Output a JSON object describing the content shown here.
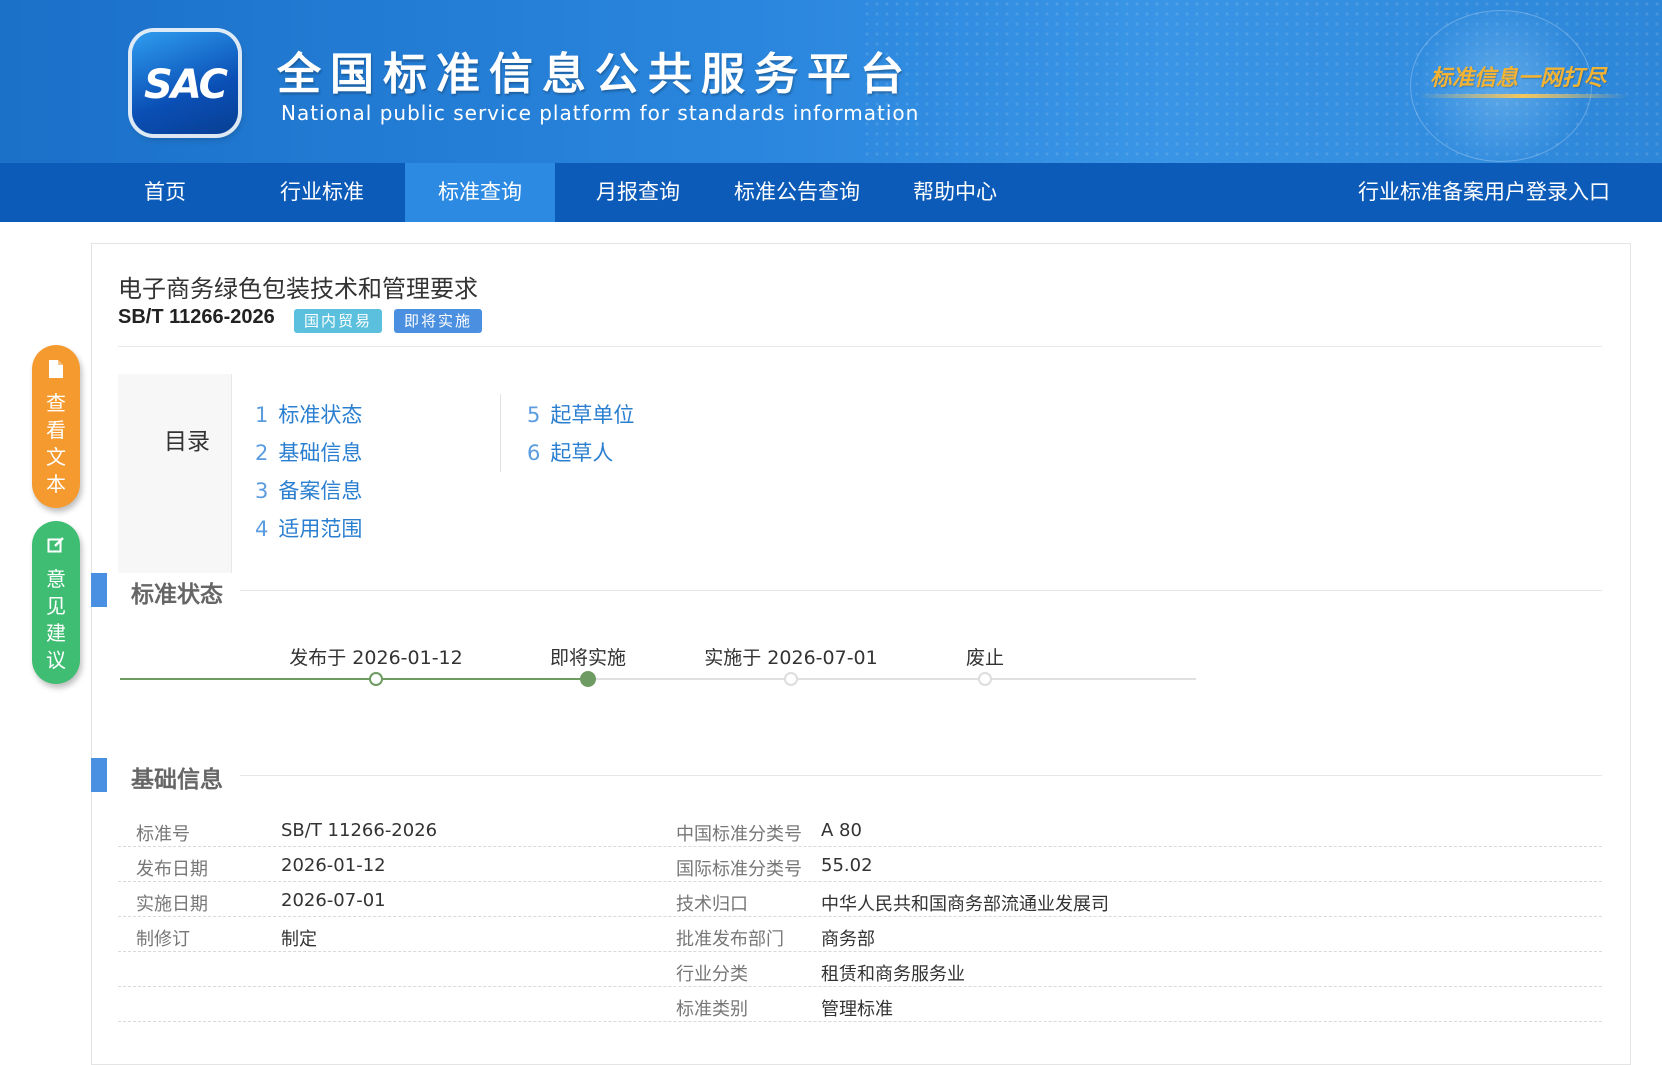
{
  "header": {
    "logo_text": "SAC",
    "title": "全国标准信息公共服务平台",
    "subtitle": "National public service platform  for standards information",
    "slogan": "标准信息一网打尽"
  },
  "nav": {
    "items": [
      {
        "label": "首页"
      },
      {
        "label": "行业标准"
      },
      {
        "label": "标准查询"
      },
      {
        "label": "月报查询"
      },
      {
        "label": "标准公告查询"
      },
      {
        "label": "帮助中心"
      }
    ],
    "active_index": 2,
    "login_label": "行业标准备案用户登录入口"
  },
  "floating": {
    "view_text": "查看文本",
    "feedback": "意见建议"
  },
  "standard": {
    "title": "电子商务绿色包装技术和管理要求",
    "code": "SB/T 11266-2026",
    "tags": [
      "国内贸易",
      "即将实施"
    ]
  },
  "toc": {
    "label": "目录",
    "col1": [
      {
        "num": "1",
        "label": "标准状态"
      },
      {
        "num": "2",
        "label": "基础信息"
      },
      {
        "num": "3",
        "label": "备案信息"
      },
      {
        "num": "4",
        "label": "适用范围"
      }
    ],
    "col2": [
      {
        "num": "5",
        "label": "起草单位"
      },
      {
        "num": "6",
        "label": "起草人"
      }
    ]
  },
  "status_section": {
    "title": "标准状态",
    "steps": [
      {
        "label": "发布于 2026-01-12",
        "state": "done"
      },
      {
        "label": "即将实施",
        "state": "current"
      },
      {
        "label": "实施于 2026-07-01",
        "state": "pending"
      },
      {
        "label": "废止",
        "state": "pending"
      }
    ]
  },
  "basic_section": {
    "title": "基础信息",
    "rows": [
      {
        "l1": "标准号",
        "v1": "SB/T 11266-2026",
        "l2": "中国标准分类号",
        "v2": "A 80"
      },
      {
        "l1": "发布日期",
        "v1": "2026-01-12",
        "l2": "国际标准分类号",
        "v2": "55.02"
      },
      {
        "l1": "实施日期",
        "v1": "2026-07-01",
        "l2": "技术归口",
        "v2": "中华人民共和国商务部流通业发展司"
      },
      {
        "l1": "制修订",
        "v1": "制定",
        "l2": "批准发布部门",
        "v2": "商务部"
      },
      {
        "l1": "",
        "v1": "",
        "l2": "行业分类",
        "v2": "租赁和商务服务业"
      },
      {
        "l1": "",
        "v1": "",
        "l2": "标准类别",
        "v2": "管理标准"
      }
    ]
  }
}
